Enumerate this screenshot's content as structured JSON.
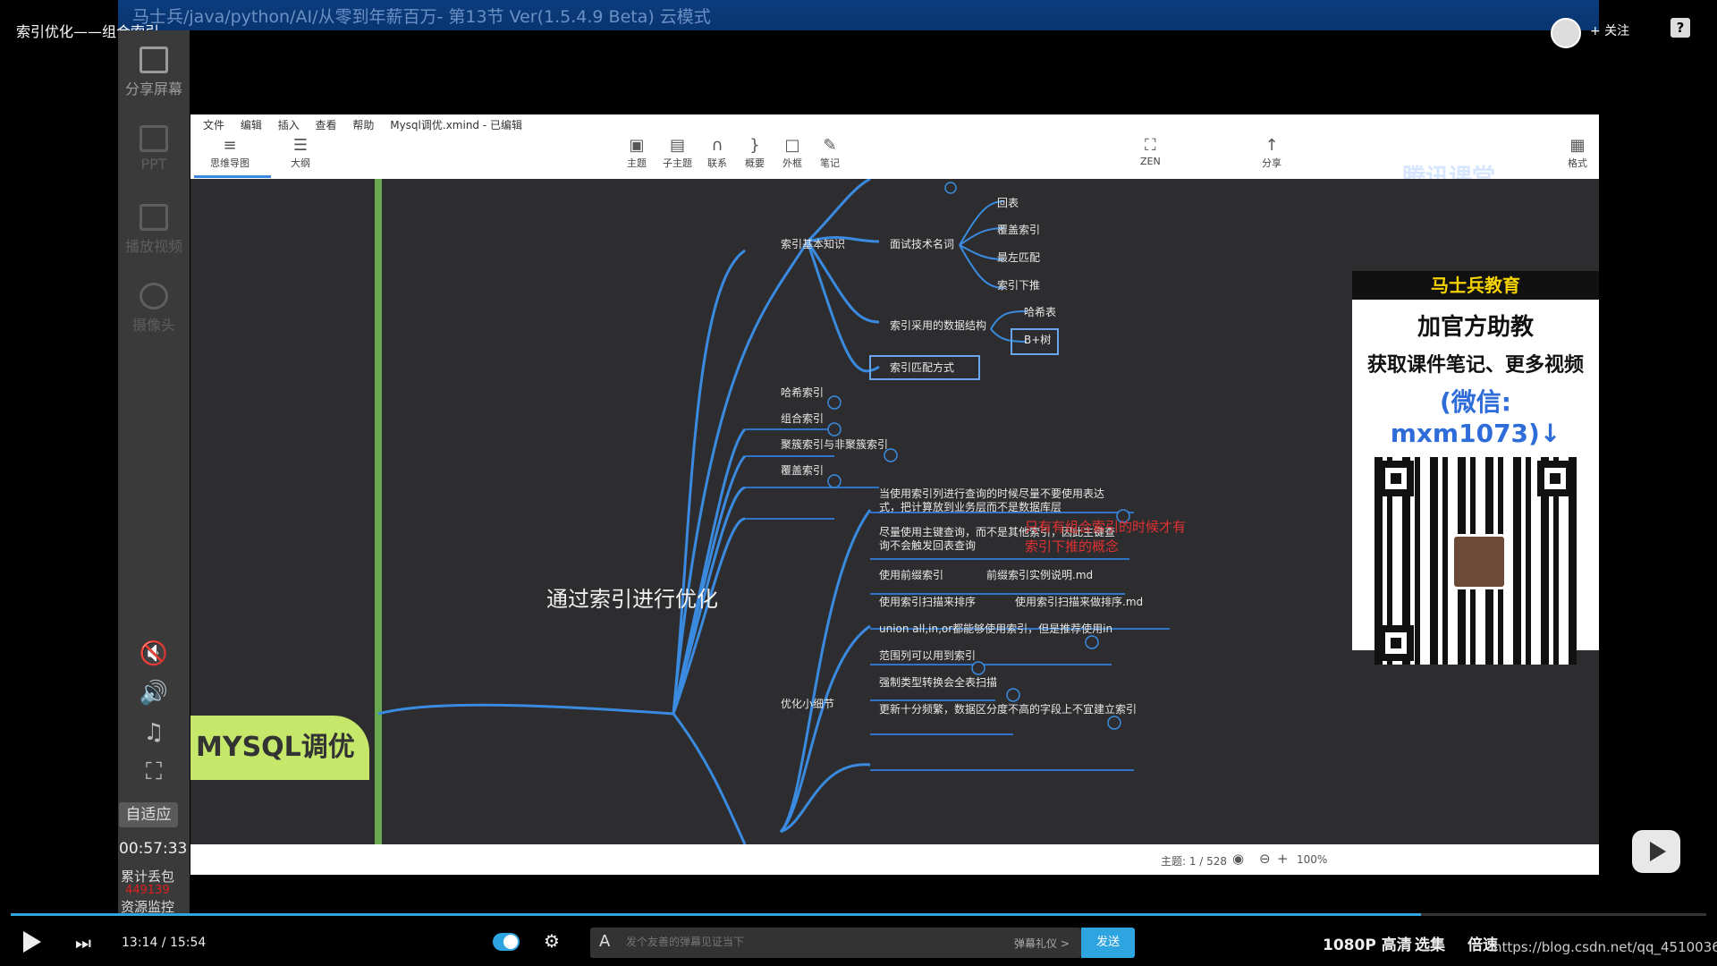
{
  "video_title": "索引优化——组合索引",
  "recorded_window_title": "马士兵/java/python/AI/从零到年薪百万- 第13节 Ver(1.5.4.9 Beta) 云模式",
  "follow_label": "+ 关注",
  "side_tools": [
    "分享屏幕",
    "PPT",
    "播放视频",
    "摄像头"
  ],
  "fit_label": "自适应",
  "session_timer": "00:57:33",
  "packet_loss_label": "累计丢包",
  "packet_loss_count": "449139",
  "resource_monitor_label": "资源监控",
  "xmind": {
    "menu": [
      "文件",
      "编辑",
      "插入",
      "查看",
      "帮助"
    ],
    "file_title": "Mysql调优.xmind - 已编辑",
    "toolbar": {
      "mindmap": "思维导图",
      "outline": "大纲",
      "topic": "主题",
      "subtopic": "子主题",
      "relation": "联系",
      "summary": "概要",
      "boundary": "外框",
      "notes": "笔记",
      "zen": "ZEN",
      "share": "分享",
      "format": "格式"
    },
    "watermark": "腾讯课堂",
    "nodes": {
      "index_basics": "索引基本知识",
      "interview_terms": "面试技术名词",
      "back_to_table": "回表",
      "covering_index": "覆盖索引",
      "leftmost_match": "最左匹配",
      "index_pushdown": "索引下推",
      "data_structure": "索引采用的数据结构",
      "hash_table": "哈希表",
      "bplus_tree": "B+树",
      "match_mode": "索引匹配方式",
      "hash_index": "哈希索引",
      "composite_index": "组合索引",
      "clustered": "聚簇索引与非聚簇索引",
      "covering": "覆盖索引",
      "main_topic": "通过索引进行优化",
      "details": "优化小细节",
      "d1": "当使用索引列进行查询的时候尽量不要使用表达式，把计算放到业务层而不是数据库层",
      "d2": "尽量使用主键查询，而不是其他索引，因此主键查询不会触发回表查询",
      "d3": "使用前缀索引",
      "d3_attach": "前缀索引实例说明.md",
      "d4": "使用索引扫描来排序",
      "d4_attach": "使用索引扫描来做排序.md",
      "d5": "union all,in,or都能够使用索引，但是推荐使用in",
      "d6": "范围列可以用到索引",
      "d7": "强制类型转换会全表扫描",
      "d8": "更新十分频繁，数据区分度不高的字段上不宜建立索引",
      "root": "MYSQL调优",
      "note": "只有有组合索引的时候才有索引下推的概念",
      "badges": [
        "5",
        "11",
        "3",
        "14",
        "11",
        "2",
        "3",
        "2",
        "4",
        "3"
      ]
    },
    "status": {
      "topic_count": "主题: 1 / 528",
      "zoom": "100%"
    }
  },
  "ad": {
    "brand": "马士兵教育",
    "line1": "加官方助教",
    "line2": "获取课件笔记、更多视频",
    "line3": "(微信: mxm1073)↓"
  },
  "player": {
    "time": "13:14 / 15:54",
    "progress_fraction": 0.832,
    "danmaku_placeholder": "发个友善的弹幕见证当下",
    "danmaku_etiquette": "弹幕礼仪 >",
    "send_label": "发送",
    "quality": "1080P 高清",
    "episodes": "选集",
    "speed": "倍速",
    "watermark": "https://blog.csdn.net/qq_45100361"
  },
  "colors": {
    "accent": "#2ea4e0",
    "mind_line": "#3a8be0",
    "root_fill": "#c6e86a",
    "note_red": "#e03030",
    "ad_brand_yellow": "#f5d200"
  }
}
